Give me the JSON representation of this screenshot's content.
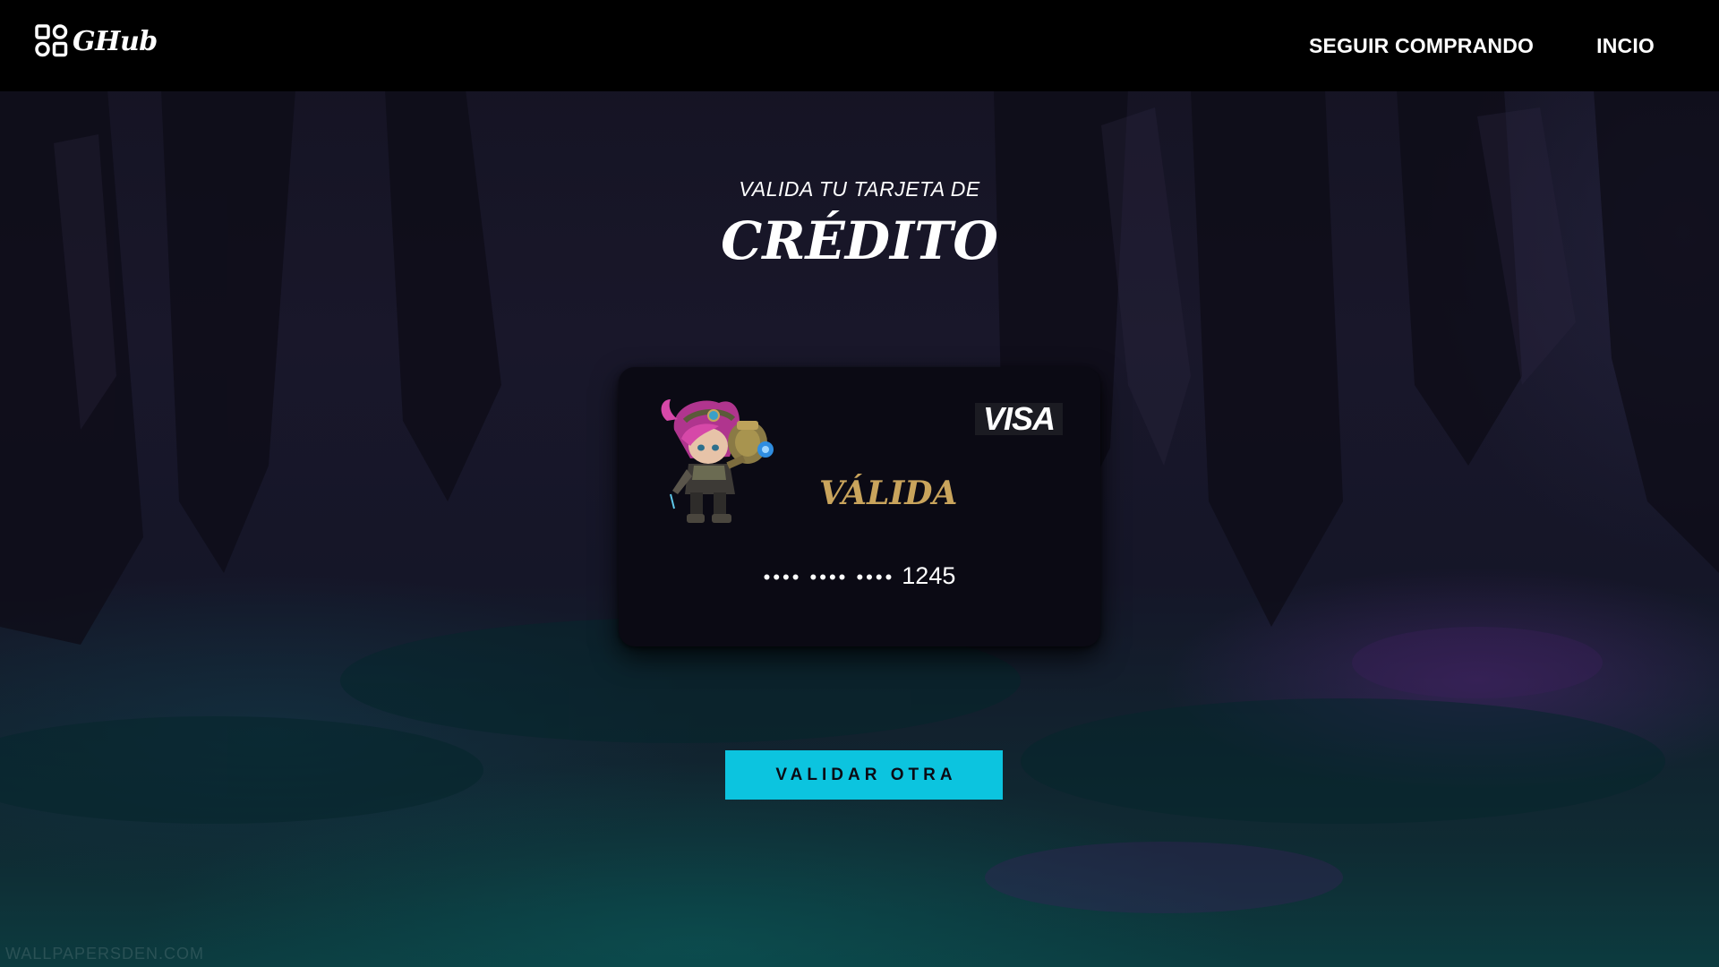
{
  "header": {
    "logo_text": "GHub",
    "nav": [
      {
        "label": "SEGUIR COMPRANDO"
      },
      {
        "label": "INCIO"
      }
    ]
  },
  "heading": {
    "subtitle": "VALIDA TU TARJETA DE",
    "title": "CRÉDITO"
  },
  "card": {
    "brand": "VISA",
    "status": "VÁLIDA",
    "masked_groups": "•••• •••• ••••",
    "last_digits": "1245",
    "avatar_icon": "chibi-champion-avatar"
  },
  "actions": {
    "validate_another_label": "VALIDAR OTRA"
  },
  "background": {
    "watermark": "WALLPAPERSDEN.COM"
  },
  "colors": {
    "accent": "#0cc4df",
    "status_gold": "#c9a45c",
    "header_bg": "#000000",
    "card_bg": "#0b0a14"
  }
}
